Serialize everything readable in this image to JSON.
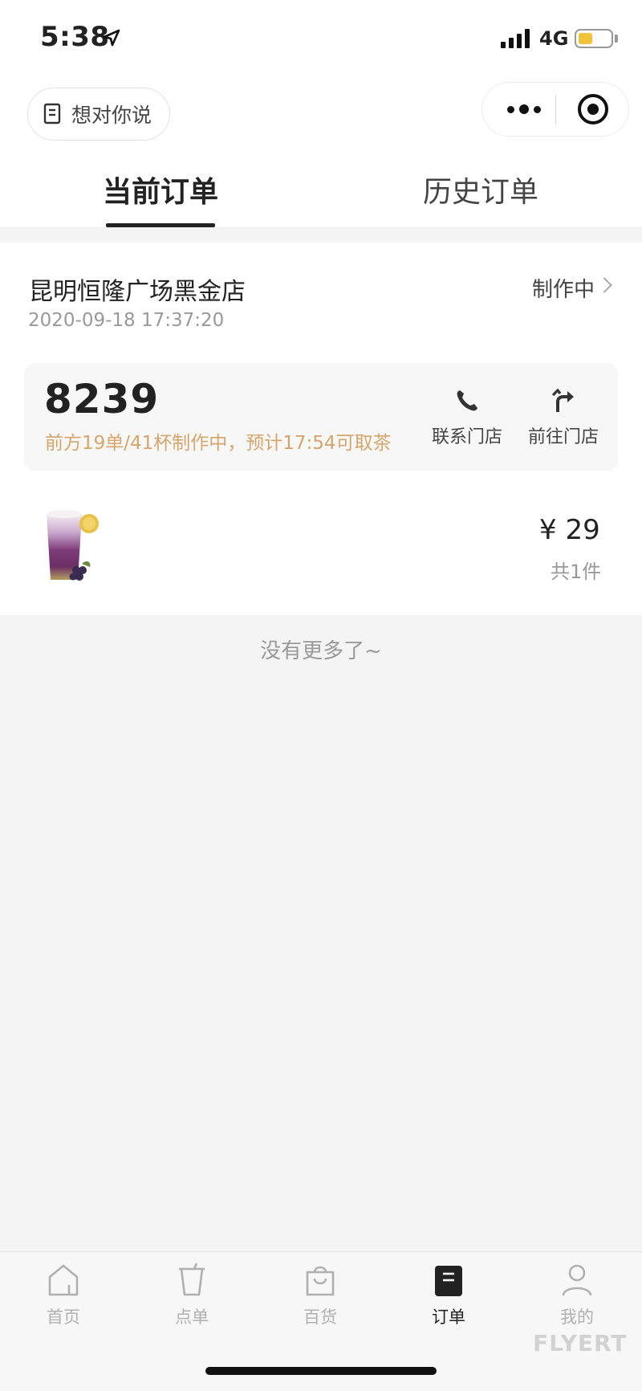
{
  "status_bar": {
    "time": "5:38",
    "network": "4G",
    "battery_level": 0.45,
    "battery_color": "#f2c23a"
  },
  "header": {
    "feedback_label": "想对你说",
    "feedback_icon": "note-icon",
    "more_icon": "more-dots-icon",
    "close_icon": "target-circle-icon"
  },
  "tabs": [
    {
      "label": "当前订单",
      "active": true
    },
    {
      "label": "历史订单",
      "active": false
    }
  ],
  "order": {
    "store_name": "昆明恒隆广场黑金店",
    "status": "制作中",
    "time": "2020-09-18 17:37:20",
    "pickup_number": "8239",
    "pickup_hint": "前方19单/41杯制作中，预计17:54可取茶",
    "actions": [
      {
        "label": "联系门店",
        "icon": "phone-icon"
      },
      {
        "label": "前往门店",
        "icon": "turn-arrow-icon"
      }
    ],
    "price": "¥ 29",
    "count": "共1件"
  },
  "list_end": "没有更多了~",
  "tabbar": [
    {
      "label": "首页",
      "icon": "home-icon",
      "active": false
    },
    {
      "label": "点单",
      "icon": "cup-icon",
      "active": false
    },
    {
      "label": "百货",
      "icon": "shopping-bag-icon",
      "active": false
    },
    {
      "label": "订单",
      "icon": "order-box-icon",
      "active": true
    },
    {
      "label": "我的",
      "icon": "user-icon",
      "active": false
    }
  ],
  "watermark": "FLYERT",
  "colors": {
    "accent_hint": "#d7a56b",
    "active_text": "#222222",
    "inactive_text": "#b0b0b0"
  }
}
